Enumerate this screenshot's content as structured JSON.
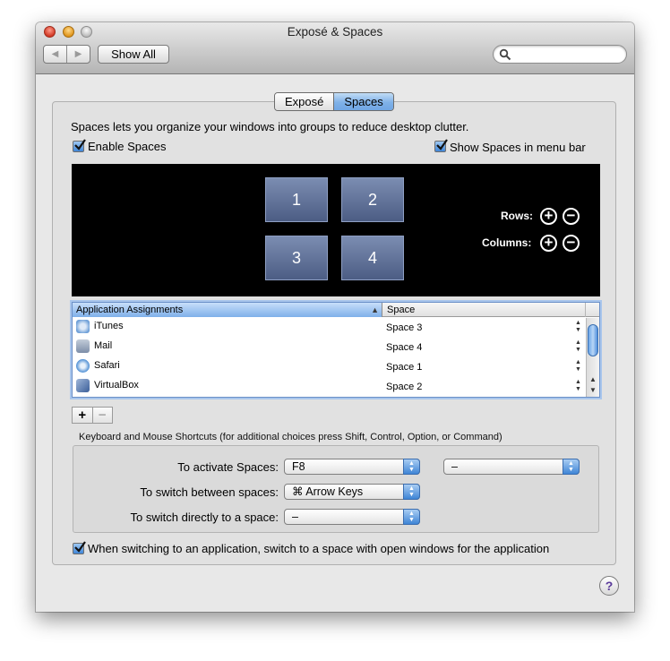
{
  "window": {
    "title": "Exposé & Spaces"
  },
  "toolbar": {
    "back_label": "◀",
    "forward_label": "▶",
    "show_all_label": "Show All",
    "search_value": "",
    "search_placeholder": ""
  },
  "tabs": [
    {
      "label": "Exposé",
      "active": false
    },
    {
      "label": "Spaces",
      "active": true
    }
  ],
  "spaces": {
    "description": "Spaces lets you organize your windows into groups to reduce desktop clutter.",
    "enable_label": "Enable Spaces",
    "enable_checked": true,
    "menu_bar_label": "Show Spaces in menu bar",
    "menu_bar_checked": true,
    "tiles": [
      "1",
      "2",
      "3",
      "4"
    ],
    "rows_label": "Rows:",
    "columns_label": "Columns:",
    "plus_icon": "+",
    "minus_icon": "−"
  },
  "assignments": {
    "header_app": "Application Assignments",
    "header_space": "Space",
    "rows": [
      {
        "app": "iTunes",
        "space": "Space 3",
        "icon": "itunes-icon",
        "color": "#6fa0d8"
      },
      {
        "app": "Mail",
        "space": "Space 4",
        "icon": "mail-icon",
        "color": "#7d8ea8"
      },
      {
        "app": "Safari",
        "space": "Space 1",
        "icon": "safari-icon",
        "color": "#4f8fd4"
      },
      {
        "app": "VirtualBox",
        "space": "Space 2",
        "icon": "virtualbox-icon",
        "color": "#3b5f9a"
      }
    ],
    "add_label": "+",
    "remove_label": "−"
  },
  "shortcuts": {
    "title": "Keyboard and Mouse Shortcuts (for additional choices press Shift, Control, Option, or Command)",
    "activate_label": "To activate Spaces:",
    "activate_value": "F8",
    "activate_mouse_value": "–",
    "switch_between_label": "To switch between spaces:",
    "switch_between_value": "⌘ Arrow Keys",
    "switch_direct_label": "To switch directly to a space:",
    "switch_direct_value": "–"
  },
  "switch_app": {
    "label": "When switching to an application, switch to a space with open windows for the application",
    "checked": true
  },
  "help": {
    "label": "?"
  }
}
